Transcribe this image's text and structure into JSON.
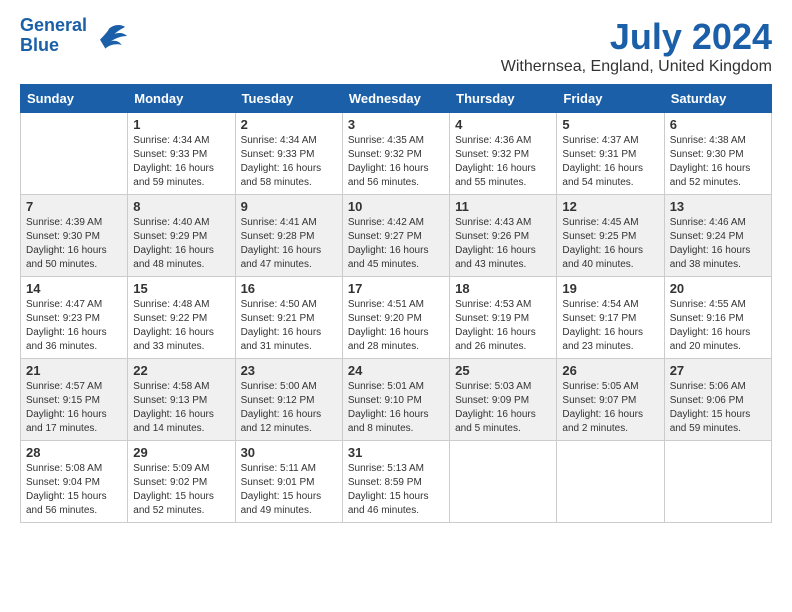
{
  "header": {
    "logo_line1": "General",
    "logo_line2": "Blue",
    "month_year": "July 2024",
    "location": "Withernsea, England, United Kingdom"
  },
  "days_of_week": [
    "Sunday",
    "Monday",
    "Tuesday",
    "Wednesday",
    "Thursday",
    "Friday",
    "Saturday"
  ],
  "weeks": [
    [
      {
        "day": "",
        "info": ""
      },
      {
        "day": "1",
        "info": "Sunrise: 4:34 AM\nSunset: 9:33 PM\nDaylight: 16 hours\nand 59 minutes."
      },
      {
        "day": "2",
        "info": "Sunrise: 4:34 AM\nSunset: 9:33 PM\nDaylight: 16 hours\nand 58 minutes."
      },
      {
        "day": "3",
        "info": "Sunrise: 4:35 AM\nSunset: 9:32 PM\nDaylight: 16 hours\nand 56 minutes."
      },
      {
        "day": "4",
        "info": "Sunrise: 4:36 AM\nSunset: 9:32 PM\nDaylight: 16 hours\nand 55 minutes."
      },
      {
        "day": "5",
        "info": "Sunrise: 4:37 AM\nSunset: 9:31 PM\nDaylight: 16 hours\nand 54 minutes."
      },
      {
        "day": "6",
        "info": "Sunrise: 4:38 AM\nSunset: 9:30 PM\nDaylight: 16 hours\nand 52 minutes."
      }
    ],
    [
      {
        "day": "7",
        "info": "Sunrise: 4:39 AM\nSunset: 9:30 PM\nDaylight: 16 hours\nand 50 minutes."
      },
      {
        "day": "8",
        "info": "Sunrise: 4:40 AM\nSunset: 9:29 PM\nDaylight: 16 hours\nand 48 minutes."
      },
      {
        "day": "9",
        "info": "Sunrise: 4:41 AM\nSunset: 9:28 PM\nDaylight: 16 hours\nand 47 minutes."
      },
      {
        "day": "10",
        "info": "Sunrise: 4:42 AM\nSunset: 9:27 PM\nDaylight: 16 hours\nand 45 minutes."
      },
      {
        "day": "11",
        "info": "Sunrise: 4:43 AM\nSunset: 9:26 PM\nDaylight: 16 hours\nand 43 minutes."
      },
      {
        "day": "12",
        "info": "Sunrise: 4:45 AM\nSunset: 9:25 PM\nDaylight: 16 hours\nand 40 minutes."
      },
      {
        "day": "13",
        "info": "Sunrise: 4:46 AM\nSunset: 9:24 PM\nDaylight: 16 hours\nand 38 minutes."
      }
    ],
    [
      {
        "day": "14",
        "info": "Sunrise: 4:47 AM\nSunset: 9:23 PM\nDaylight: 16 hours\nand 36 minutes."
      },
      {
        "day": "15",
        "info": "Sunrise: 4:48 AM\nSunset: 9:22 PM\nDaylight: 16 hours\nand 33 minutes."
      },
      {
        "day": "16",
        "info": "Sunrise: 4:50 AM\nSunset: 9:21 PM\nDaylight: 16 hours\nand 31 minutes."
      },
      {
        "day": "17",
        "info": "Sunrise: 4:51 AM\nSunset: 9:20 PM\nDaylight: 16 hours\nand 28 minutes."
      },
      {
        "day": "18",
        "info": "Sunrise: 4:53 AM\nSunset: 9:19 PM\nDaylight: 16 hours\nand 26 minutes."
      },
      {
        "day": "19",
        "info": "Sunrise: 4:54 AM\nSunset: 9:17 PM\nDaylight: 16 hours\nand 23 minutes."
      },
      {
        "day": "20",
        "info": "Sunrise: 4:55 AM\nSunset: 9:16 PM\nDaylight: 16 hours\nand 20 minutes."
      }
    ],
    [
      {
        "day": "21",
        "info": "Sunrise: 4:57 AM\nSunset: 9:15 PM\nDaylight: 16 hours\nand 17 minutes."
      },
      {
        "day": "22",
        "info": "Sunrise: 4:58 AM\nSunset: 9:13 PM\nDaylight: 16 hours\nand 14 minutes."
      },
      {
        "day": "23",
        "info": "Sunrise: 5:00 AM\nSunset: 9:12 PM\nDaylight: 16 hours\nand 12 minutes."
      },
      {
        "day": "24",
        "info": "Sunrise: 5:01 AM\nSunset: 9:10 PM\nDaylight: 16 hours\nand 8 minutes."
      },
      {
        "day": "25",
        "info": "Sunrise: 5:03 AM\nSunset: 9:09 PM\nDaylight: 16 hours\nand 5 minutes."
      },
      {
        "day": "26",
        "info": "Sunrise: 5:05 AM\nSunset: 9:07 PM\nDaylight: 16 hours\nand 2 minutes."
      },
      {
        "day": "27",
        "info": "Sunrise: 5:06 AM\nSunset: 9:06 PM\nDaylight: 15 hours\nand 59 minutes."
      }
    ],
    [
      {
        "day": "28",
        "info": "Sunrise: 5:08 AM\nSunset: 9:04 PM\nDaylight: 15 hours\nand 56 minutes."
      },
      {
        "day": "29",
        "info": "Sunrise: 5:09 AM\nSunset: 9:02 PM\nDaylight: 15 hours\nand 52 minutes."
      },
      {
        "day": "30",
        "info": "Sunrise: 5:11 AM\nSunset: 9:01 PM\nDaylight: 15 hours\nand 49 minutes."
      },
      {
        "day": "31",
        "info": "Sunrise: 5:13 AM\nSunset: 8:59 PM\nDaylight: 15 hours\nand 46 minutes."
      },
      {
        "day": "",
        "info": ""
      },
      {
        "day": "",
        "info": ""
      },
      {
        "day": "",
        "info": ""
      }
    ]
  ]
}
